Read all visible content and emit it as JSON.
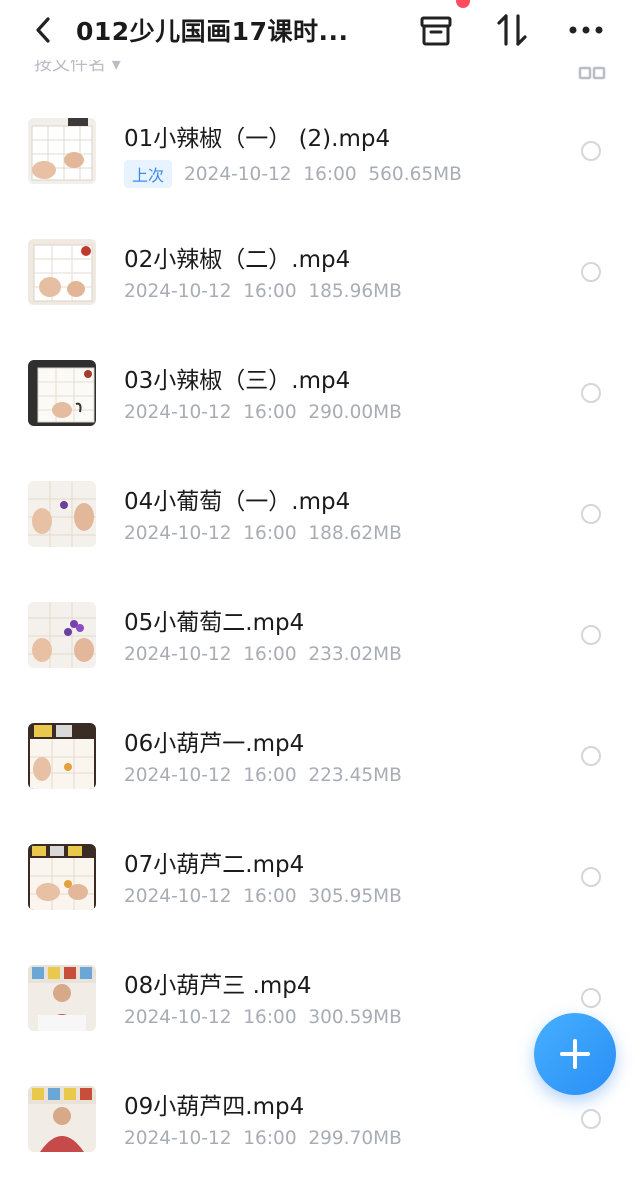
{
  "header": {
    "title": "012少儿国画17课时...",
    "icons": [
      "back-icon",
      "archive-icon",
      "sort-icon",
      "more-icon"
    ],
    "notification_dot_color": "#ff4d5e"
  },
  "subbar": {
    "sort_label": "按文件名 ▾"
  },
  "files": [
    {
      "name": "01小辣椒（一） (2).mp4",
      "badge": "上次",
      "date": "2024-10-12",
      "time": "16:00",
      "size": "560.65MB"
    },
    {
      "name": "02小辣椒（二）.mp4",
      "date": "2024-10-12",
      "time": "16:00",
      "size": "185.96MB"
    },
    {
      "name": "03小辣椒（三）.mp4",
      "date": "2024-10-12",
      "time": "16:00",
      "size": "290.00MB"
    },
    {
      "name": "04小葡萄（一）.mp4",
      "date": "2024-10-12",
      "time": "16:00",
      "size": "188.62MB"
    },
    {
      "name": "05小葡萄二.mp4",
      "date": "2024-10-12",
      "time": "16:00",
      "size": "233.02MB"
    },
    {
      "name": "06小葫芦一.mp4",
      "date": "2024-10-12",
      "time": "16:00",
      "size": "223.45MB"
    },
    {
      "name": "07小葫芦二.mp4",
      "date": "2024-10-12",
      "time": "16:00",
      "size": "305.95MB"
    },
    {
      "name": "08小葫芦三 .mp4",
      "date": "2024-10-12",
      "time": "16:00",
      "size": "300.59MB"
    },
    {
      "name": "09小葫芦四.mp4",
      "date": "2024-10-12",
      "time": "16:00",
      "size": "299.70MB"
    }
  ],
  "colors": {
    "accent": "#2a8ef6",
    "meta_text": "#a8adb5",
    "badge_bg": "#e9f3ff"
  }
}
